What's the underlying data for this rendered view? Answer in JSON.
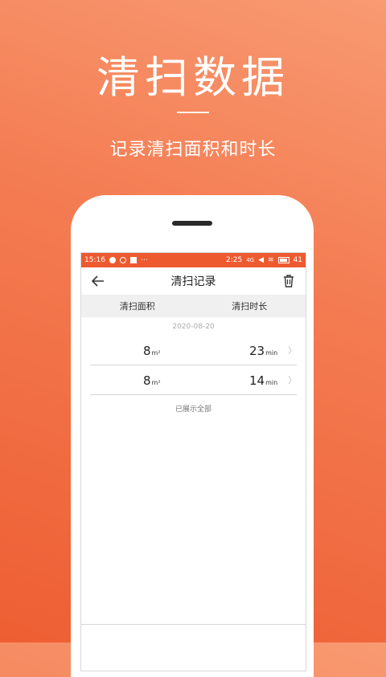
{
  "promo": {
    "title": "清扫数据",
    "subtitle": "记录清扫面积和时长"
  },
  "statusbar": {
    "time": "15:16",
    "clock": "2:25",
    "network": "4G",
    "battery": "41"
  },
  "navbar": {
    "title": "清扫记录",
    "back_icon": "back-arrow-icon",
    "delete_icon": "trash-icon"
  },
  "table": {
    "col_area": "清扫面积",
    "col_duration": "清扫时长",
    "date": "2020-08-20",
    "rows": [
      {
        "area": "8",
        "area_unit": "m²",
        "duration": "23",
        "duration_unit": "min"
      },
      {
        "area": "8",
        "area_unit": "m²",
        "duration": "14",
        "duration_unit": "min"
      }
    ],
    "footer": "已展示全部"
  },
  "colors": {
    "accent": "#ee5a30",
    "background_top": "#f89a72",
    "background_bottom": "#ee5e33"
  }
}
